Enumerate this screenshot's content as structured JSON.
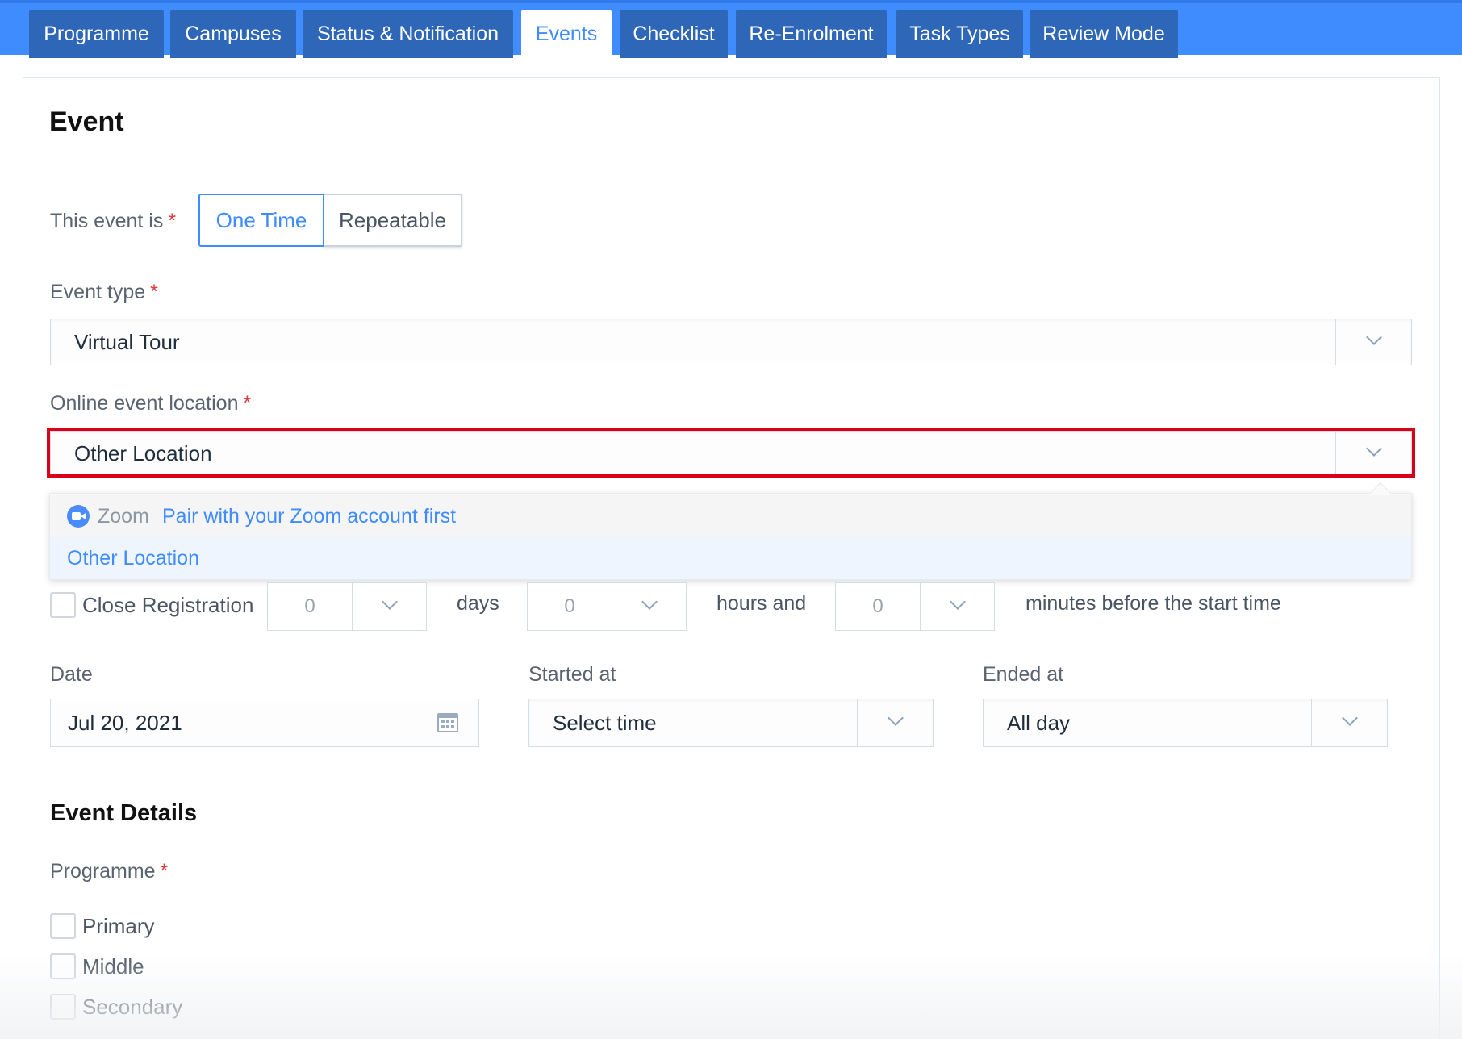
{
  "tabs": [
    {
      "label": "Programme"
    },
    {
      "label": "Campuses"
    },
    {
      "label": "Status & Notification"
    },
    {
      "label": "Events"
    },
    {
      "label": "Checklist"
    },
    {
      "label": "Re-Enrolment"
    },
    {
      "label": "Task Types"
    },
    {
      "label": "Review Mode"
    }
  ],
  "active_tab": "Events",
  "section_title": "Event",
  "event_kind": {
    "label": "This event is",
    "required_mark": "*",
    "options": [
      "One Time",
      "Repeatable"
    ],
    "selected": "One Time"
  },
  "event_type": {
    "label": "Event type",
    "required_mark": "*",
    "value": "Virtual Tour"
  },
  "online_location": {
    "label": "Online event location",
    "required_mark": "*",
    "value": "Other Location",
    "options": [
      {
        "name": "Zoom",
        "note": "Pair with your Zoom account first"
      },
      {
        "name": "Other Location"
      }
    ]
  },
  "close_registration": {
    "label": "Close Registration",
    "checked": false,
    "days": "0",
    "days_unit": "days",
    "hours": "0",
    "hours_unit": "hours and",
    "minutes": "0",
    "minutes_unit": "minutes before the start time"
  },
  "date": {
    "label": "Date",
    "value": "Jul 20, 2021"
  },
  "started_at": {
    "label": "Started at",
    "value": "Select time"
  },
  "ended_at": {
    "label": "Ended at",
    "value": "All day"
  },
  "details_title": "Event Details",
  "programme": {
    "label": "Programme",
    "required_mark": "*",
    "options": [
      "Primary",
      "Middle",
      "Secondary"
    ]
  },
  "colors": {
    "accent": "#3f8cff",
    "tab_bg": "#2e66b8",
    "required": "#e03a3a",
    "highlight": "#d9001b"
  }
}
